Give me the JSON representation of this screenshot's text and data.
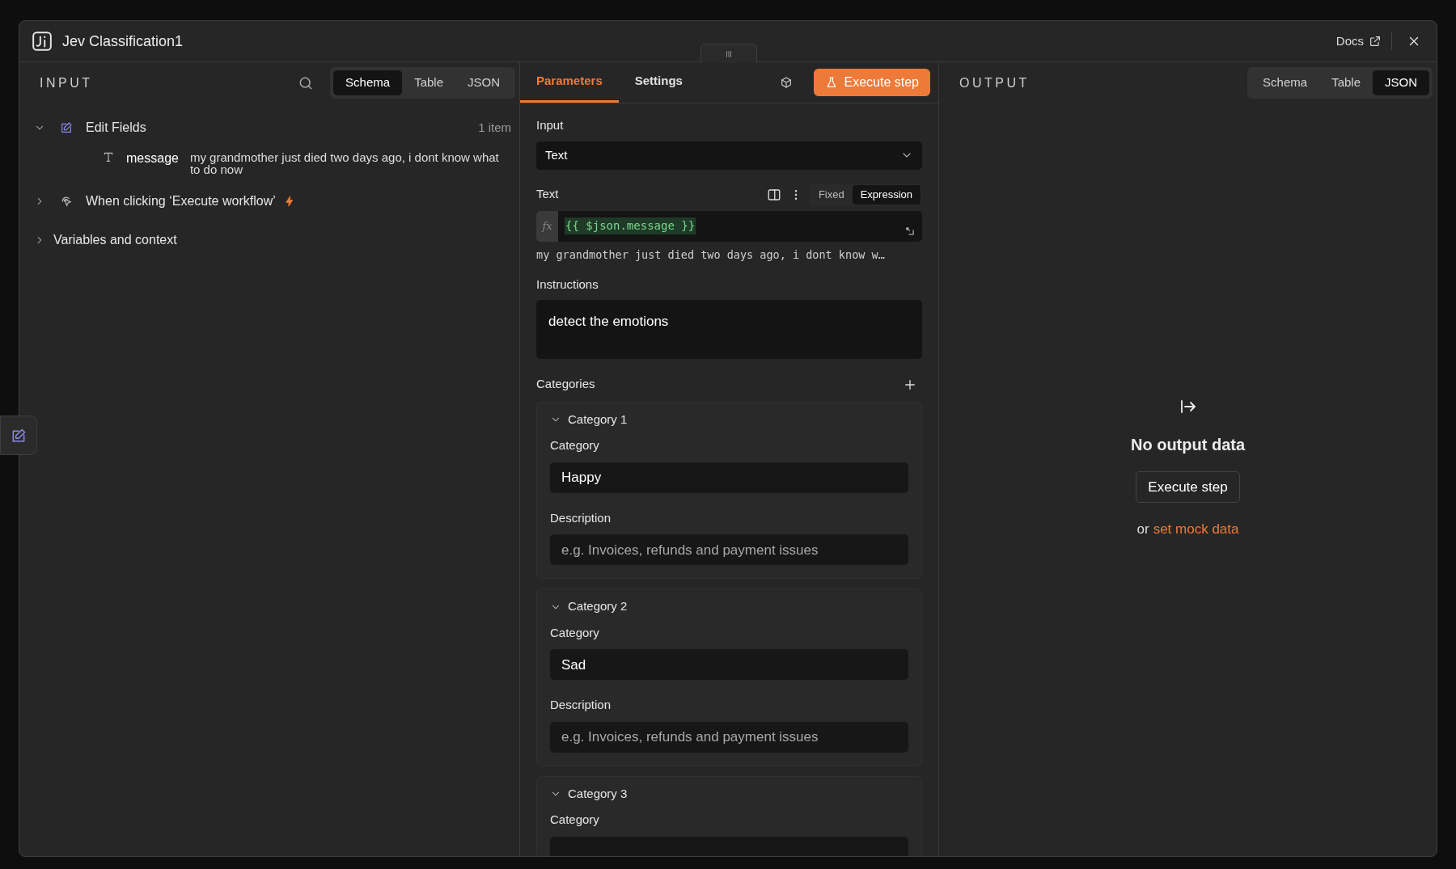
{
  "window": {
    "title": "Jev Classification1",
    "docs_link": "Docs"
  },
  "input_panel": {
    "heading": "INPUT",
    "view_tabs": [
      {
        "label": "Schema",
        "selected": true
      },
      {
        "label": "Table",
        "selected": false
      },
      {
        "label": "JSON",
        "selected": false
      }
    ],
    "tree": [
      {
        "kind": "node",
        "label": "Edit Fields",
        "expanded": true,
        "count": "1 item",
        "children": [
          {
            "kind": "field",
            "name": "message",
            "value": "my grandmother just died two days ago, i dont know what to do now"
          }
        ]
      },
      {
        "kind": "trigger",
        "label": "When clicking ‘Execute workflow’",
        "expanded": false
      },
      {
        "kind": "section",
        "label": "Variables and context",
        "expanded": false
      }
    ]
  },
  "parameters_panel": {
    "tabs": [
      {
        "label": "Parameters",
        "selected": true
      },
      {
        "label": "Settings",
        "selected": false
      }
    ],
    "execute_button": "Execute step",
    "input_field": {
      "label": "Input",
      "value": "Text"
    },
    "text_field": {
      "label": "Text",
      "mode_tabs": [
        {
          "label": "Fixed",
          "selected": false
        },
        {
          "label": "Expression",
          "selected": true
        }
      ],
      "fx": "fx",
      "expression": "{{ $json.message }}",
      "preview": "my grandmother just died two days ago, i dont know w…"
    },
    "instructions": {
      "label": "Instructions",
      "value": "detect the emotions"
    },
    "categories": {
      "label": "Categories",
      "items": [
        {
          "title": "Category 1",
          "expanded": true,
          "category_label": "Category",
          "category_value": "Happy",
          "description_label": "Description",
          "description_placeholder": "e.g. Invoices, refunds and payment issues"
        },
        {
          "title": "Category 2",
          "expanded": true,
          "category_label": "Category",
          "category_value": "Sad",
          "description_label": "Description",
          "description_placeholder": "e.g. Invoices, refunds and payment issues"
        },
        {
          "title": "Category 3",
          "expanded": true,
          "category_label": "Category"
        }
      ]
    }
  },
  "output_panel": {
    "heading": "OUTPUT",
    "view_tabs": [
      {
        "label": "Schema",
        "selected": false
      },
      {
        "label": "Table",
        "selected": false
      },
      {
        "label": "JSON",
        "selected": true
      }
    ],
    "empty_title": "No output data",
    "execute_button": "Execute step",
    "mock_prefix": "or",
    "mock_link": "set mock data"
  }
}
